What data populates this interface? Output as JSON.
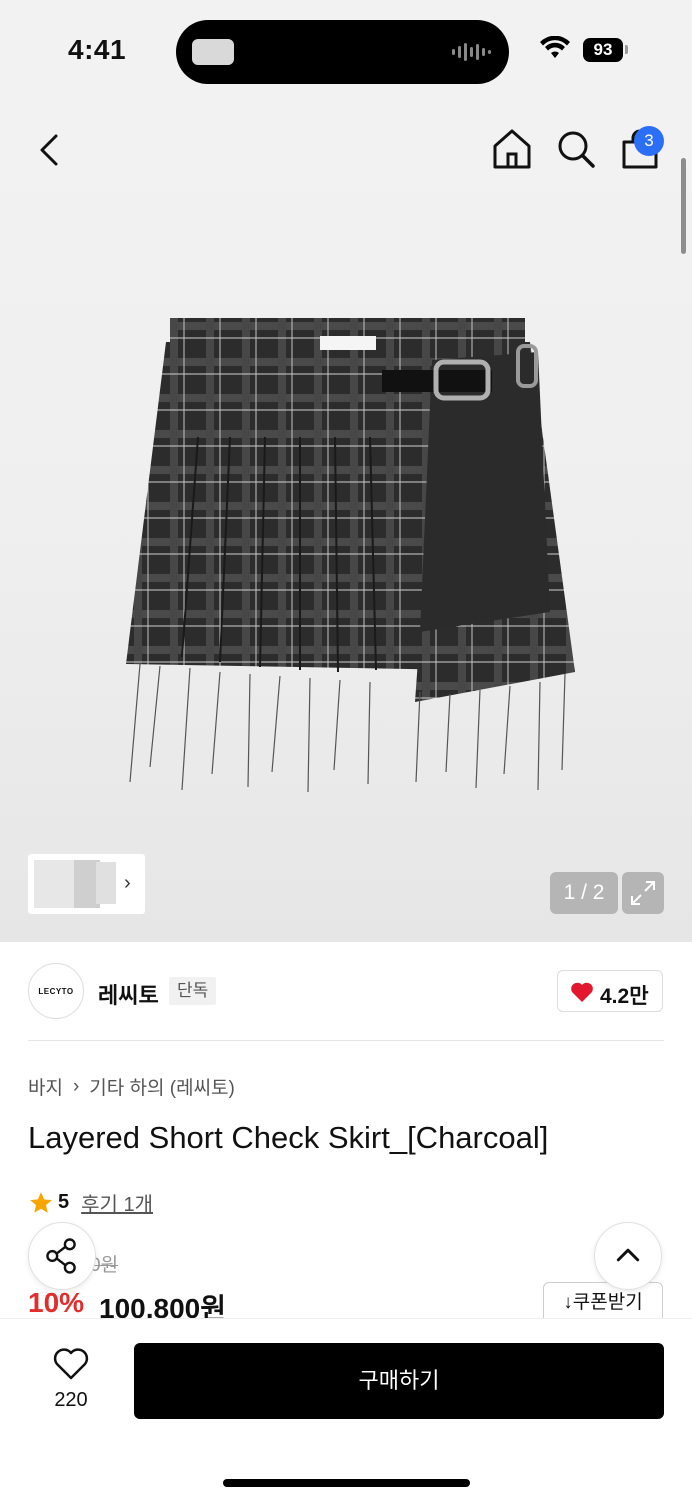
{
  "status_bar": {
    "time": "4:41",
    "battery": "93"
  },
  "nav": {
    "cart_count": "3"
  },
  "gallery": {
    "page_counter": "1 / 2"
  },
  "brand": {
    "logo_text": "LECYTO",
    "name": "레씨토",
    "tag": "단독",
    "likes": "4.2만"
  },
  "breadcrumb": {
    "category": "바지",
    "subcategory": "기타 하의 (레씨토)"
  },
  "product": {
    "title": "Layered Short Check Skirt_[Charcoal]",
    "rating": "5",
    "review_link": "후기 1개",
    "original_price": "0원",
    "discount": "10%",
    "price": "100,800원"
  },
  "actions": {
    "coupon": "쿠폰받기",
    "wish_count": "220",
    "buy": "구매하기"
  },
  "colors": {
    "accent_blue": "#2b6ff7",
    "sale_red": "#e32d2d",
    "heart_red": "#e3162e"
  }
}
